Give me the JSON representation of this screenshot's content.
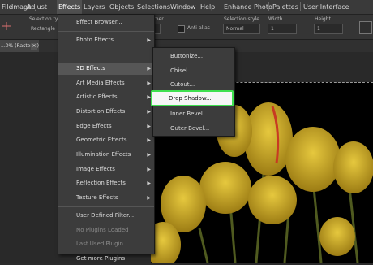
{
  "menubar": {
    "items": [
      {
        "label": "File"
      },
      {
        "label": "Image"
      },
      {
        "label": "Adjust"
      },
      {
        "label": "Effects"
      },
      {
        "label": "Layers"
      },
      {
        "label": "Objects"
      },
      {
        "label": "Selections"
      },
      {
        "label": "Window"
      },
      {
        "label": "Help"
      },
      {
        "label": "Enhance Photo"
      },
      {
        "label": "Palettes"
      },
      {
        "label": "User Interface"
      }
    ],
    "active": "Effects"
  },
  "toolbar": {
    "selection_type_label": "Selection type",
    "selection_type_value": "Rectangle",
    "feather_label": "...ather",
    "antialias_label": "Anti-alias",
    "selection_style_label": "Selection style",
    "selection_style_value": "Normal",
    "width_label": "Width",
    "width_value": "1",
    "height_label": "Height",
    "height_value": "1"
  },
  "document_tab": {
    "label": "...0% (Raster 1)",
    "close": "×"
  },
  "effects_menu": {
    "items": [
      {
        "label": "Effect Browser..."
      },
      {
        "label": "Photo Effects"
      },
      {
        "label": "3D Effects"
      },
      {
        "label": "Art Media Effects"
      },
      {
        "label": "Artistic Effects"
      },
      {
        "label": "Distortion Effects"
      },
      {
        "label": "Edge Effects"
      },
      {
        "label": "Geometric Effects"
      },
      {
        "label": "Illumination Effects"
      },
      {
        "label": "Image Effects"
      },
      {
        "label": "Reflection Effects"
      },
      {
        "label": "Texture Effects"
      },
      {
        "label": "User Defined Filter..."
      },
      {
        "label": "No Plugins Loaded"
      },
      {
        "label": "Last Used Plugin"
      },
      {
        "label": "Get more Plugins"
      }
    ]
  },
  "submenu_3d": {
    "items": [
      {
        "label": "Buttonize..."
      },
      {
        "label": "Chisel..."
      },
      {
        "label": "Cutout..."
      },
      {
        "label": "Drop Shadow..."
      },
      {
        "label": "Inner Bevel..."
      },
      {
        "label": "Outer Bevel..."
      }
    ]
  },
  "colors": {
    "highlight_border": "#3fe04f",
    "tulip_yellow": "#e0c23a",
    "stem_green": "#4f5a1f",
    "stripe_red": "#c83a22"
  }
}
